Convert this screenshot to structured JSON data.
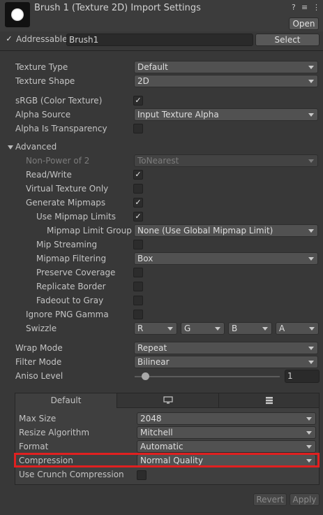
{
  "header": {
    "title": "Brush 1 (Texture 2D) Import Settings",
    "help_icon": "?",
    "settings_icon": "≡",
    "more_icon": "⋮",
    "open_label": "Open",
    "addressable_label": "Addressable",
    "addressable_checked": true,
    "address_value": "Brush1",
    "select_label": "Select"
  },
  "properties": {
    "texture_type": {
      "label": "Texture Type",
      "value": "Default"
    },
    "texture_shape": {
      "label": "Texture Shape",
      "value": "2D"
    },
    "srgb": {
      "label": "sRGB (Color Texture)",
      "checked": true
    },
    "alpha_source": {
      "label": "Alpha Source",
      "value": "Input Texture Alpha"
    },
    "alpha_is_transparency": {
      "label": "Alpha Is Transparency",
      "checked": false
    }
  },
  "advanced": {
    "label": "Advanced",
    "non_power_of_2": {
      "label": "Non-Power of 2",
      "value": "ToNearest"
    },
    "read_write": {
      "label": "Read/Write",
      "checked": true
    },
    "virtual_texture_only": {
      "label": "Virtual Texture Only",
      "checked": false
    },
    "generate_mipmaps": {
      "label": "Generate Mipmaps",
      "checked": true
    },
    "use_mipmap_limits": {
      "label": "Use Mipmap Limits",
      "checked": true
    },
    "mipmap_limit_group": {
      "label": "Mipmap Limit Group",
      "value": "None (Use Global Mipmap Limit)"
    },
    "mip_streaming": {
      "label": "Mip Streaming",
      "checked": false
    },
    "mipmap_filtering": {
      "label": "Mipmap Filtering",
      "value": "Box"
    },
    "preserve_coverage": {
      "label": "Preserve Coverage",
      "checked": false
    },
    "replicate_border": {
      "label": "Replicate Border",
      "checked": false
    },
    "fadeout_to_gray": {
      "label": "Fadeout to Gray",
      "checked": false
    },
    "ignore_png_gamma": {
      "label": "Ignore PNG Gamma",
      "checked": false
    },
    "swizzle": {
      "label": "Swizzle",
      "r": "R",
      "g": "G",
      "b": "B",
      "a": "A"
    }
  },
  "wrap_mode": {
    "label": "Wrap Mode",
    "value": "Repeat"
  },
  "filter_mode": {
    "label": "Filter Mode",
    "value": "Bilinear"
  },
  "aniso_level": {
    "label": "Aniso Level",
    "value": "1",
    "slider_fraction": 0.0
  },
  "platform": {
    "tabs": [
      {
        "label": "Default",
        "icon": "default-tab"
      },
      {
        "label": "",
        "icon": "monitor-icon"
      },
      {
        "label": "",
        "icon": "server-icon"
      }
    ],
    "max_size": {
      "label": "Max Size",
      "value": "2048"
    },
    "resize_algorithm": {
      "label": "Resize Algorithm",
      "value": "Mitchell"
    },
    "format": {
      "label": "Format",
      "value": "Automatic"
    },
    "compression": {
      "label": "Compression",
      "value": "Normal Quality"
    },
    "use_crunch": {
      "label": "Use Crunch Compression",
      "checked": false
    }
  },
  "footer": {
    "revert_label": "Revert",
    "apply_label": "Apply"
  },
  "colors": {
    "highlight": "#e02020",
    "background": "#383838",
    "field": "#2a2a2a"
  }
}
